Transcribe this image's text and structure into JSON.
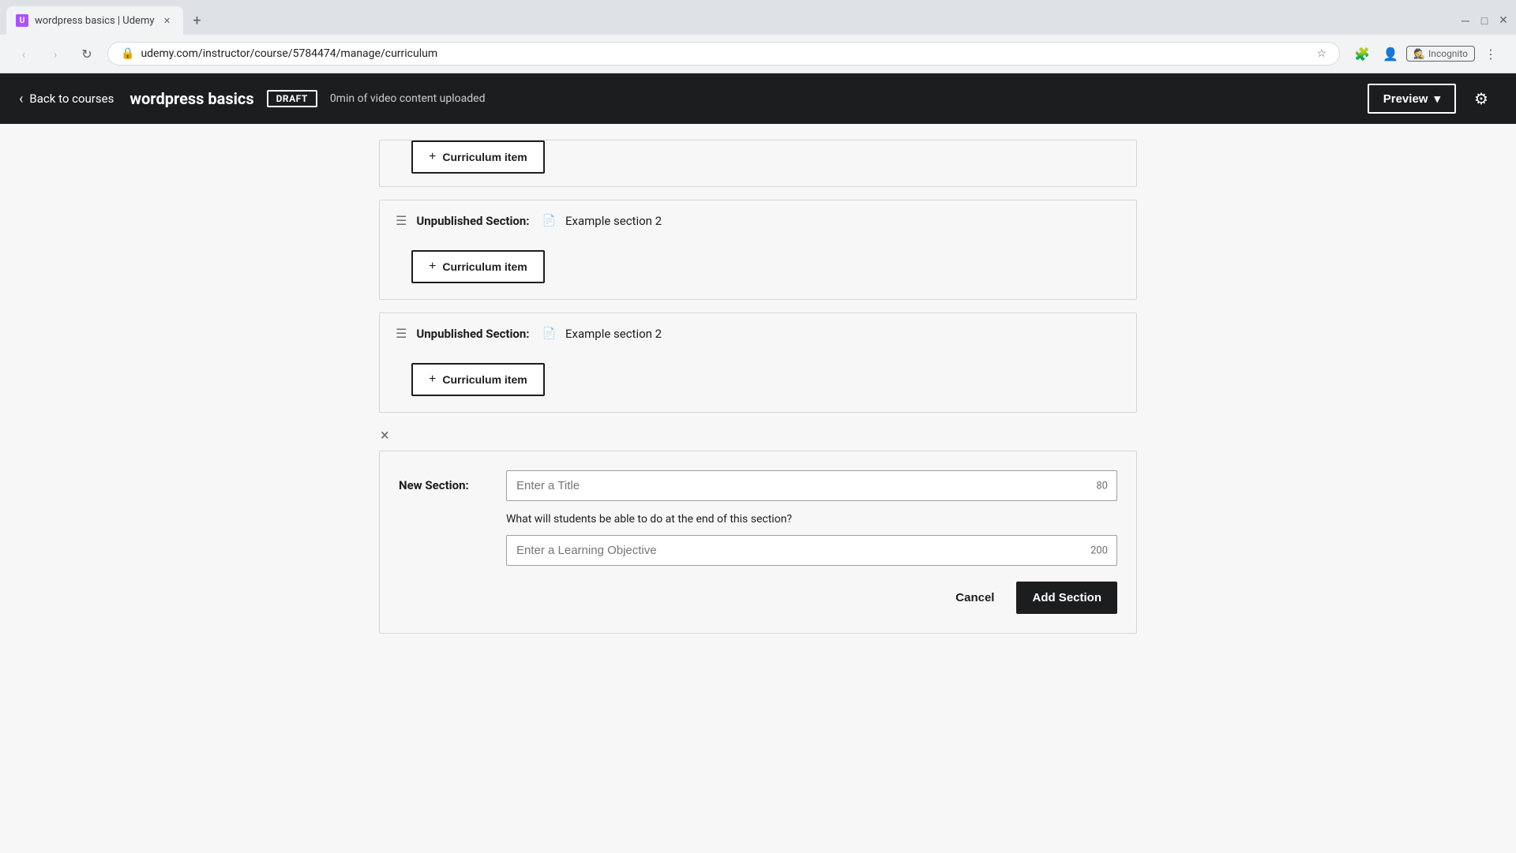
{
  "browser": {
    "tab_title": "wordpress basics | Udemy",
    "url": "udemy.com/instructor/course/5784474/manage/curriculum",
    "incognito_label": "Incognito"
  },
  "header": {
    "back_label": "Back to courses",
    "course_title": "wordpress basics",
    "draft_badge": "DRAFT",
    "upload_info": "0min of video content uploaded",
    "preview_label": "Preview",
    "settings_icon": "⚙"
  },
  "sections": [
    {
      "label": "Unpublished Section:",
      "icon": "📄",
      "title": "Example section 2",
      "curriculum_item_label": "Curriculum item"
    },
    {
      "label": "Unpublished Section:",
      "icon": "📄",
      "title": "Example section 2",
      "curriculum_item_label": "Curriculum item"
    }
  ],
  "new_section_form": {
    "close_label": "×",
    "label": "New Section:",
    "title_placeholder": "Enter a Title",
    "title_char_count": "80",
    "objective_question": "What will students be able to do at the end of this section?",
    "objective_placeholder": "Enter a Learning Objective",
    "objective_char_count": "200",
    "cancel_label": "Cancel",
    "add_section_label": "Add Section"
  }
}
